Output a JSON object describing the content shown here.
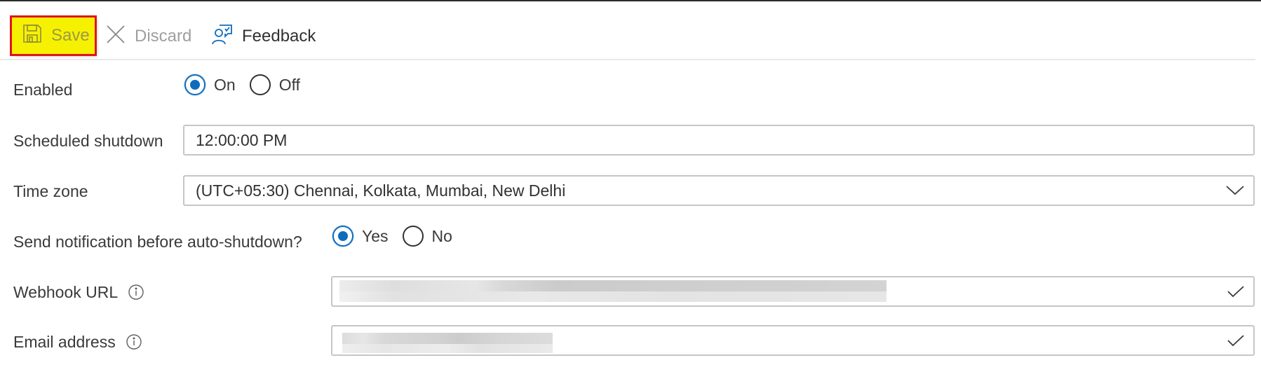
{
  "toolbar": {
    "save": {
      "label": "Save",
      "icon": "save-icon",
      "highlighted": true
    },
    "discard": {
      "label": "Discard",
      "icon": "close-icon"
    },
    "feedback": {
      "label": "Feedback",
      "icon": "feedback-icon"
    }
  },
  "form": {
    "enabled": {
      "label": "Enabled",
      "options": [
        {
          "label": "On",
          "selected": true
        },
        {
          "label": "Off",
          "selected": false
        }
      ]
    },
    "scheduled_shutdown": {
      "label": "Scheduled shutdown",
      "value": "12:00:00 PM"
    },
    "time_zone": {
      "label": "Time zone",
      "value": "(UTC+05:30) Chennai, Kolkata, Mumbai, New Delhi",
      "icon": "chevron-down-icon"
    },
    "send_notification": {
      "label": "Send notification before auto-shutdown?",
      "options": [
        {
          "label": "Yes",
          "selected": true
        },
        {
          "label": "No",
          "selected": false
        }
      ]
    },
    "webhook_url": {
      "label": "Webhook URL",
      "value": "[redacted]",
      "validated": true,
      "icon": "info-icon"
    },
    "email_address": {
      "label": "Email address",
      "value": "[redacted]",
      "validated": true,
      "icon": "info-icon"
    }
  },
  "colors": {
    "accent": "#0f6cbd",
    "highlight": "#f6f100",
    "highlight_border": "#e0141c"
  }
}
